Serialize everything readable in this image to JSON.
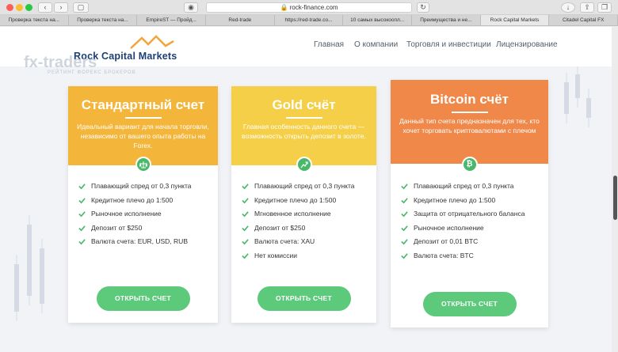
{
  "browser": {
    "url": "rock-finance.com",
    "tabs": [
      "Проверка текста на...",
      "Проверка текста на...",
      "EmpireST — Пройд...",
      "Red-trade",
      "https://red-trade.co...",
      "10 самых высокоопл...",
      "Преимущества и не...",
      "Rock Capital Markets",
      "Citadel Capital FX"
    ],
    "active_tab": 7
  },
  "watermark": {
    "title": "fx-traders",
    "subtitle": "РЕЙТИНГ ФОРЕКС БРОКЕРОВ"
  },
  "header": {
    "logo": "Rock Capital Markets",
    "nav": [
      "Главная",
      "О компании",
      "Торговля и инвестиции",
      "Лицензирование"
    ]
  },
  "cards": [
    {
      "title": "Стандартный счет",
      "description": "Идеальный вариант для начала торговли, независимо от вашего опыта работы на Forex.",
      "icon": "scale-icon",
      "color": "#f4b53b",
      "features": [
        "Плавающий спред от 0,3 пункта",
        "Кредитное плечо до 1:500",
        "Рыночное исполнение",
        "Депозит от $250",
        "Валюта счета: EUR, USD, RUB"
      ],
      "button": "ОТКРЫТЬ СЧЕТ"
    },
    {
      "title": "Gold счёт",
      "description": "Главная особенность данного счета — возможность открыть депозит в золоте.",
      "icon": "chart-arrow-icon",
      "color": "#f4cf47",
      "features": [
        "Плавающий спред от 0,3 пункта",
        "Кредитное плечо до 1:500",
        "Мгновенное исполнение",
        "Депозит от $250",
        "Валюта счета: XAU",
        "Нет комиссии"
      ],
      "button": "ОТКРЫТЬ СЧЕТ"
    },
    {
      "title": "Bitcoin счёт",
      "description": "Данный тип счета предназначен для тех, кто хочет торговать криптовалютами с плечом",
      "icon": "bitcoin-icon",
      "color": "#f0884a",
      "features": [
        "Плавающий спред от 0,3 пункта",
        "Кредитное плечо до 1:500",
        "Защита от отрицательного баланса",
        "Рыночное исполнение",
        "Депозит от 0,01 BTC",
        "Валюта счета: BTC"
      ],
      "button": "ОТКРЫТЬ СЧЕТ"
    }
  ],
  "colors": {
    "button": "#5cc97b",
    "check": "#4ab86a",
    "logo": "#1d3f73"
  }
}
